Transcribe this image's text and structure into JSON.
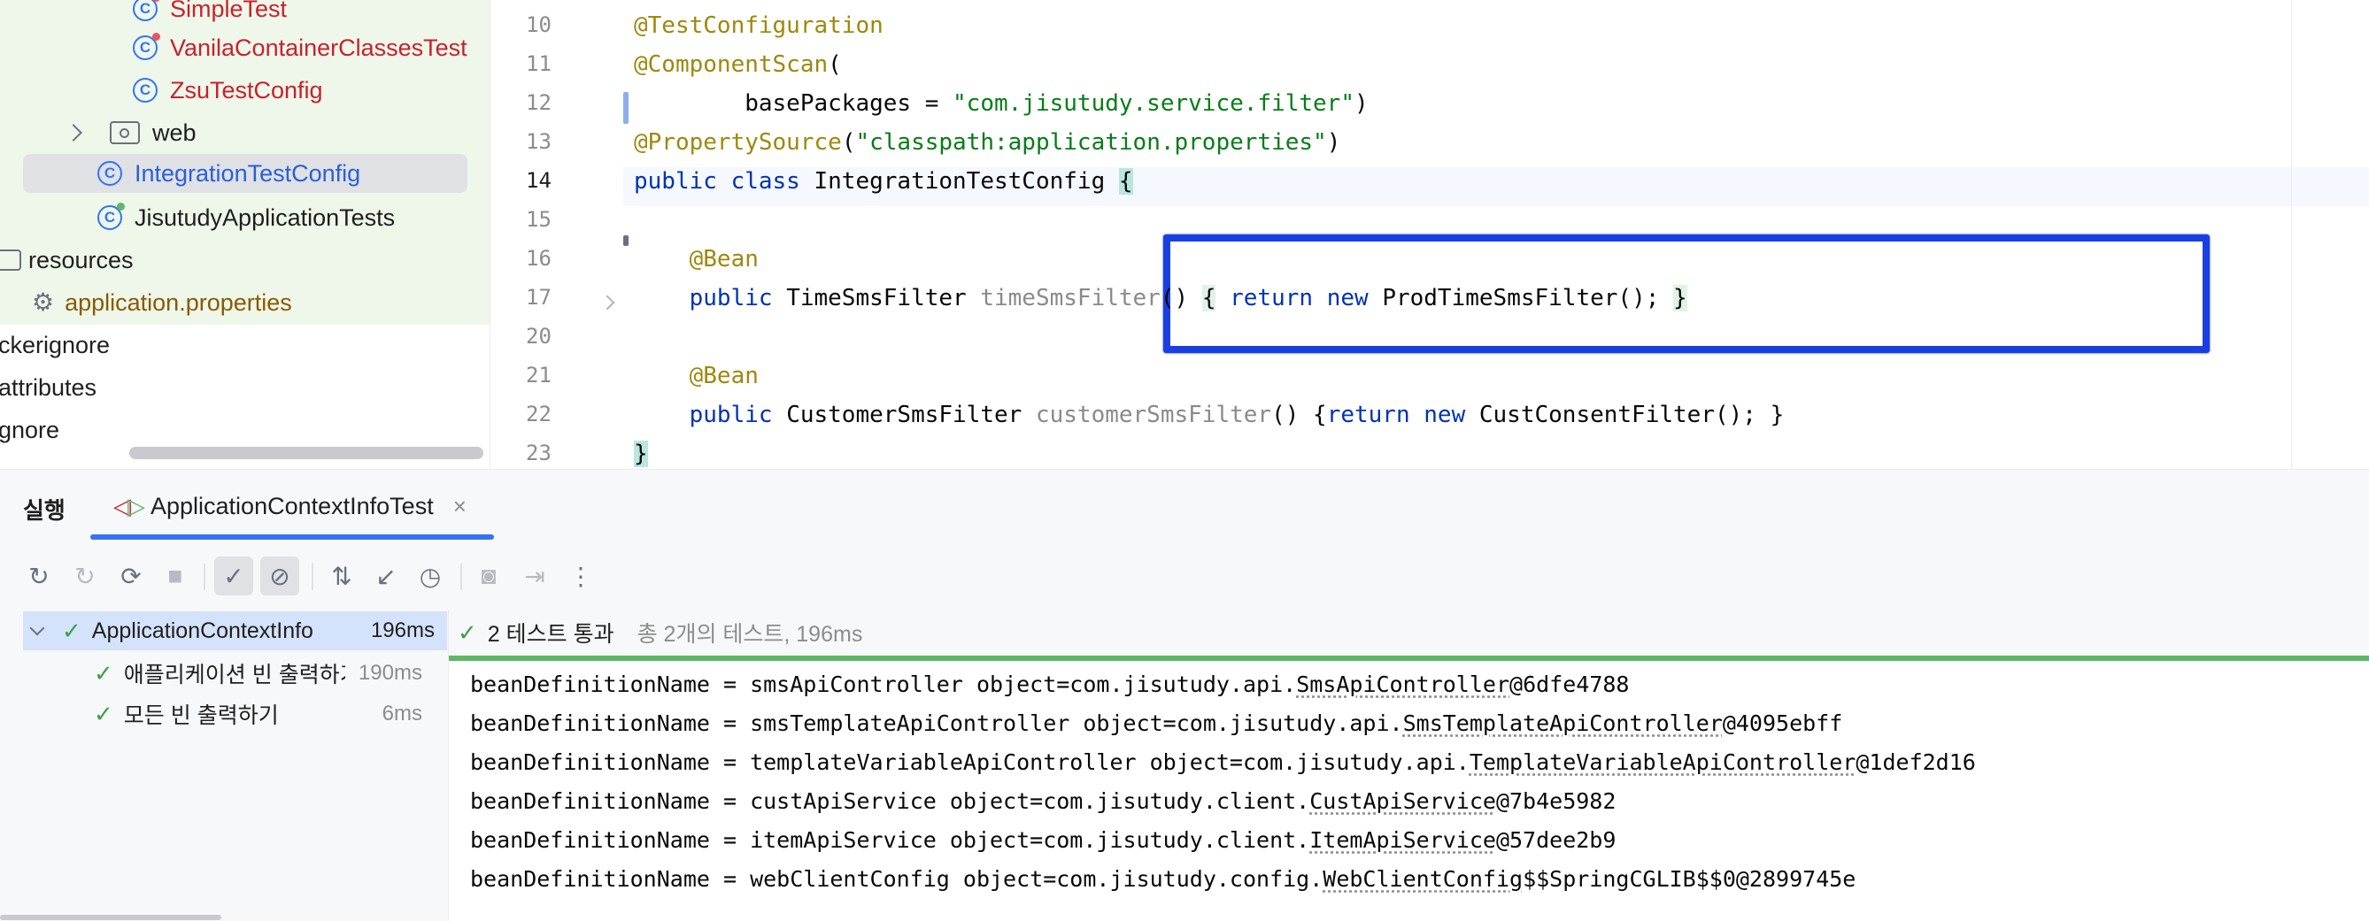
{
  "project_tree": {
    "items": [
      {
        "label": "SimpleTest",
        "kind": "test-class"
      },
      {
        "label": "VanilaContainerClassesTest",
        "kind": "test-class"
      },
      {
        "label": "ZsuTestConfig",
        "kind": "test-class"
      },
      {
        "label": "web",
        "kind": "folder"
      },
      {
        "label": "IntegrationTestConfig",
        "kind": "class-selected"
      },
      {
        "label": "JisutudyApplicationTests",
        "kind": "test-class-green"
      },
      {
        "label": "resources",
        "kind": "resources-folder"
      },
      {
        "label": "application.properties",
        "kind": "properties-file"
      },
      {
        "label": "ckerignore",
        "kind": "file"
      },
      {
        "label": "attributes",
        "kind": "file"
      },
      {
        "label": "gnore",
        "kind": "file"
      }
    ]
  },
  "editor": {
    "line_numbers": [
      "10",
      "11",
      "12",
      "13",
      "14",
      "15",
      "16",
      "17",
      "20",
      "21",
      "22",
      "23"
    ],
    "current_line": "14",
    "lines": [
      {
        "parts": [
          {
            "t": "@TestConfiguration",
            "c": "ann"
          }
        ]
      },
      {
        "parts": [
          {
            "t": "@ComponentScan",
            "c": "ann"
          },
          {
            "t": "(",
            "c": ""
          }
        ]
      },
      {
        "parts": [
          {
            "t": "        basePackages = ",
            "c": ""
          },
          {
            "t": "\"com.jisutudy.service.filter\"",
            "c": "str"
          },
          {
            "t": ")",
            "c": ""
          }
        ]
      },
      {
        "parts": [
          {
            "t": "@PropertySource",
            "c": "ann"
          },
          {
            "t": "(",
            "c": ""
          },
          {
            "t": "\"classpath:application.properties\"",
            "c": "str"
          },
          {
            "t": ")",
            "c": ""
          }
        ]
      },
      {
        "parts": [
          {
            "t": "public class ",
            "c": "kw"
          },
          {
            "t": "IntegrationTestConfig ",
            "c": ""
          },
          {
            "t": "{",
            "c": "brc"
          }
        ]
      },
      {
        "parts": []
      },
      {
        "parts": [
          {
            "t": "    @Bean",
            "c": "ann"
          }
        ]
      },
      {
        "parts": [
          {
            "t": "    public ",
            "c": "kw"
          },
          {
            "t": "TimeSmsFilter ",
            "c": ""
          },
          {
            "t": "timeSmsFilter",
            "c": "fn"
          },
          {
            "t": "() ",
            "c": ""
          },
          {
            "t": "{",
            "c": "br"
          },
          {
            "t": " ",
            "c": ""
          },
          {
            "t": "return new ",
            "c": "kw"
          },
          {
            "t": "ProdTimeSmsFilter(); ",
            "c": ""
          },
          {
            "t": "}",
            "c": "br"
          }
        ]
      },
      {
        "parts": []
      },
      {
        "parts": [
          {
            "t": "    @Bean",
            "c": "ann"
          }
        ]
      },
      {
        "parts": [
          {
            "t": "    public ",
            "c": "kw"
          },
          {
            "t": "CustomerSmsFilter ",
            "c": ""
          },
          {
            "t": "customerSmsFilter",
            "c": "fn"
          },
          {
            "t": "() {",
            "c": ""
          },
          {
            "t": "return new ",
            "c": "kw"
          },
          {
            "t": "CustConsentFilter(); }",
            "c": ""
          }
        ]
      },
      {
        "parts": [
          {
            "t": "}",
            "c": "brc"
          }
        ]
      }
    ]
  },
  "run_panel": {
    "title": "실행",
    "tab_label": "ApplicationContextInfoTest",
    "tab_close": "×",
    "toolbar_icons": [
      "rerun-icon",
      "rerun-failed-icon",
      "toggle-auto-test-icon",
      "stop-icon",
      "show-passed-icon",
      "show-ignored-icon",
      "sort-icon",
      "collapse-icon",
      "history-icon",
      "screenshot-icon",
      "import-icon",
      "more-icon"
    ],
    "test_tree": [
      {
        "name": "ApplicationContextInfo",
        "time": "196ms",
        "level": 0
      },
      {
        "name": "애플리케이션 빈 출력하기",
        "time": "190ms",
        "level": 1
      },
      {
        "name": "모든 빈 출력하기",
        "time": "6ms",
        "level": 1
      }
    ],
    "status": {
      "check": "✓",
      "text": "2 테스트 통과",
      "summary": "총 2개의 테스트, 196ms"
    },
    "console_lines": [
      {
        "prefix": "beanDefinitionName = smsApiController object=com.jisutudy.api.",
        "link": "SmsApiController",
        "suffix": "@6dfe4788"
      },
      {
        "prefix": "beanDefinitionName = smsTemplateApiController object=com.jisutudy.api.",
        "link": "SmsTemplateApiController",
        "suffix": "@4095ebff"
      },
      {
        "prefix": "beanDefinitionName = templateVariableApiController object=com.jisutudy.api.",
        "link": "TemplateVariableApiController",
        "suffix": "@1def2d16"
      },
      {
        "prefix": "beanDefinitionName = custApiService object=com.jisutudy.client.",
        "link": "CustApiService",
        "suffix": "@7b4e5982"
      },
      {
        "prefix": "beanDefinitionName = itemApiService object=com.jisutudy.client.",
        "link": "ItemApiService",
        "suffix": "@57dee2b9"
      },
      {
        "prefix": "beanDefinitionName = webClientConfig object=com.jisutudy.config.",
        "link": "WebClientConfig",
        "suffix": "$$SpringCGLIB$$0@2899745e"
      }
    ]
  },
  "colors": {
    "accent": "#3574f0",
    "highlight_box": "#1a3fe0",
    "pass_green": "#5fb865"
  }
}
